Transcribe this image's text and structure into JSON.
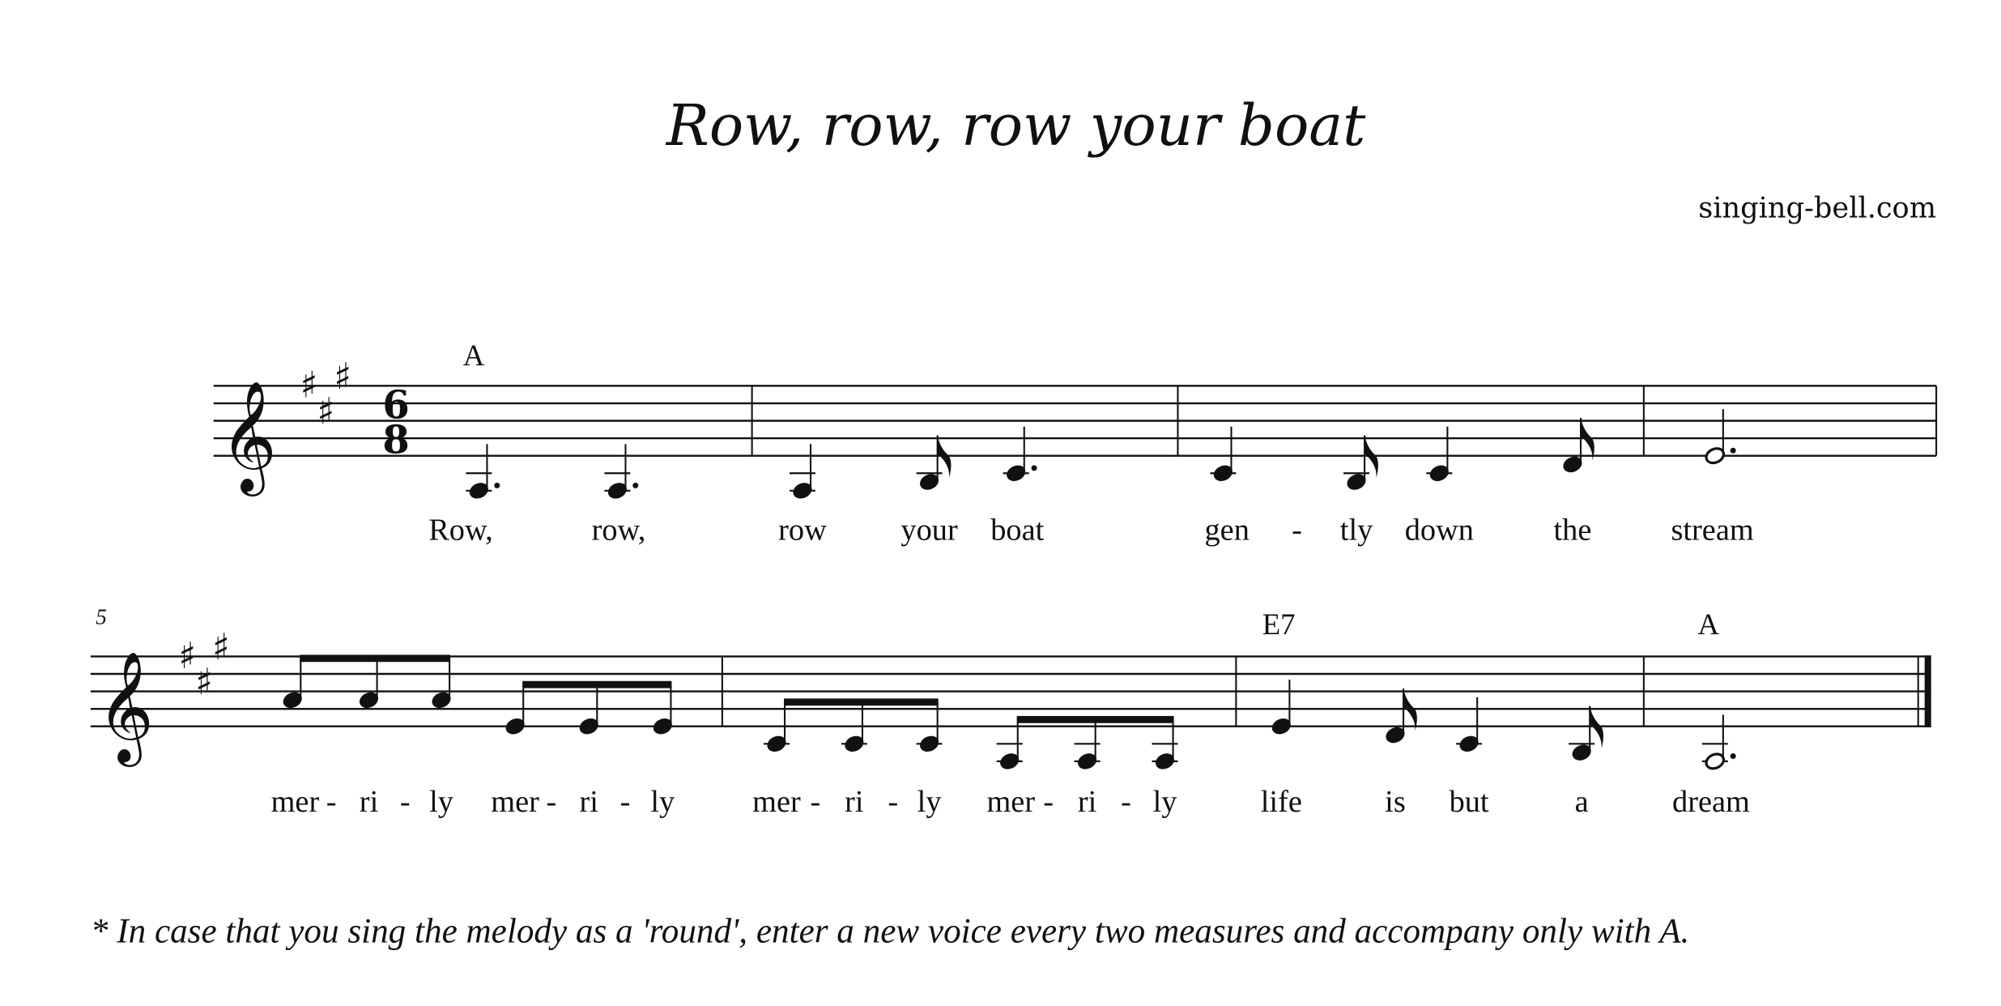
{
  "title": "Row, row, row your boat",
  "site": "singing-bell.com",
  "key_signature": {
    "name": "A major",
    "sharps": [
      "F#",
      "C#",
      "G#"
    ]
  },
  "time_signature": {
    "numerator": "6",
    "denominator": "8"
  },
  "clef": "treble",
  "systems": [
    {
      "measure_number": "",
      "chords": [
        {
          "label": "A",
          "measure": 1
        }
      ],
      "measures": [
        {
          "notes": [
            {
              "pitch": "A3",
              "duration": "dotted-quarter"
            },
            {
              "pitch": "A3",
              "duration": "dotted-quarter"
            }
          ]
        },
        {
          "notes": [
            {
              "pitch": "A3",
              "duration": "quarter"
            },
            {
              "pitch": "B3",
              "duration": "eighth"
            },
            {
              "pitch": "C#4",
              "duration": "dotted-quarter"
            }
          ]
        },
        {
          "notes": [
            {
              "pitch": "C#4",
              "duration": "quarter"
            },
            {
              "pitch": "B3",
              "duration": "eighth"
            },
            {
              "pitch": "C#4",
              "duration": "quarter"
            },
            {
              "pitch": "D4",
              "duration": "eighth"
            }
          ]
        },
        {
          "notes": [
            {
              "pitch": "E4",
              "duration": "dotted-half"
            }
          ]
        }
      ],
      "lyrics": [
        "Row,",
        "row,",
        "row",
        "your",
        "boat",
        "gen",
        "-",
        "tly",
        "down",
        "the",
        "stream"
      ]
    },
    {
      "measure_number": "5",
      "chords": [
        {
          "label": "E7",
          "measure": 7
        },
        {
          "label": "A",
          "measure": 8
        }
      ],
      "measures": [
        {
          "notes": [
            {
              "pitch": "A4",
              "duration": "eighth"
            },
            {
              "pitch": "A4",
              "duration": "eighth"
            },
            {
              "pitch": "A4",
              "duration": "eighth"
            },
            {
              "pitch": "E4",
              "duration": "eighth"
            },
            {
              "pitch": "E4",
              "duration": "eighth"
            },
            {
              "pitch": "E4",
              "duration": "eighth"
            }
          ]
        },
        {
          "notes": [
            {
              "pitch": "C#4",
              "duration": "eighth"
            },
            {
              "pitch": "C#4",
              "duration": "eighth"
            },
            {
              "pitch": "C#4",
              "duration": "eighth"
            },
            {
              "pitch": "A3",
              "duration": "eighth"
            },
            {
              "pitch": "A3",
              "duration": "eighth"
            },
            {
              "pitch": "A3",
              "duration": "eighth"
            }
          ]
        },
        {
          "notes": [
            {
              "pitch": "E4",
              "duration": "quarter"
            },
            {
              "pitch": "D4",
              "duration": "eighth"
            },
            {
              "pitch": "C#4",
              "duration": "quarter"
            },
            {
              "pitch": "B3",
              "duration": "eighth"
            }
          ]
        },
        {
          "notes": [
            {
              "pitch": "A3",
              "duration": "dotted-half"
            }
          ]
        }
      ],
      "lyrics": [
        "mer",
        "-",
        "ri",
        "-",
        "ly",
        "mer",
        "-",
        "ri",
        "-",
        "ly",
        "mer",
        "-",
        "ri",
        "-",
        "ly",
        "mer",
        "-",
        "ri",
        "-",
        "ly",
        "life",
        "is",
        "but",
        "a",
        "dream"
      ]
    }
  ],
  "footnote": "* In case that you sing the melody as a 'round', enter a new voice every two measures and accompany only with A."
}
